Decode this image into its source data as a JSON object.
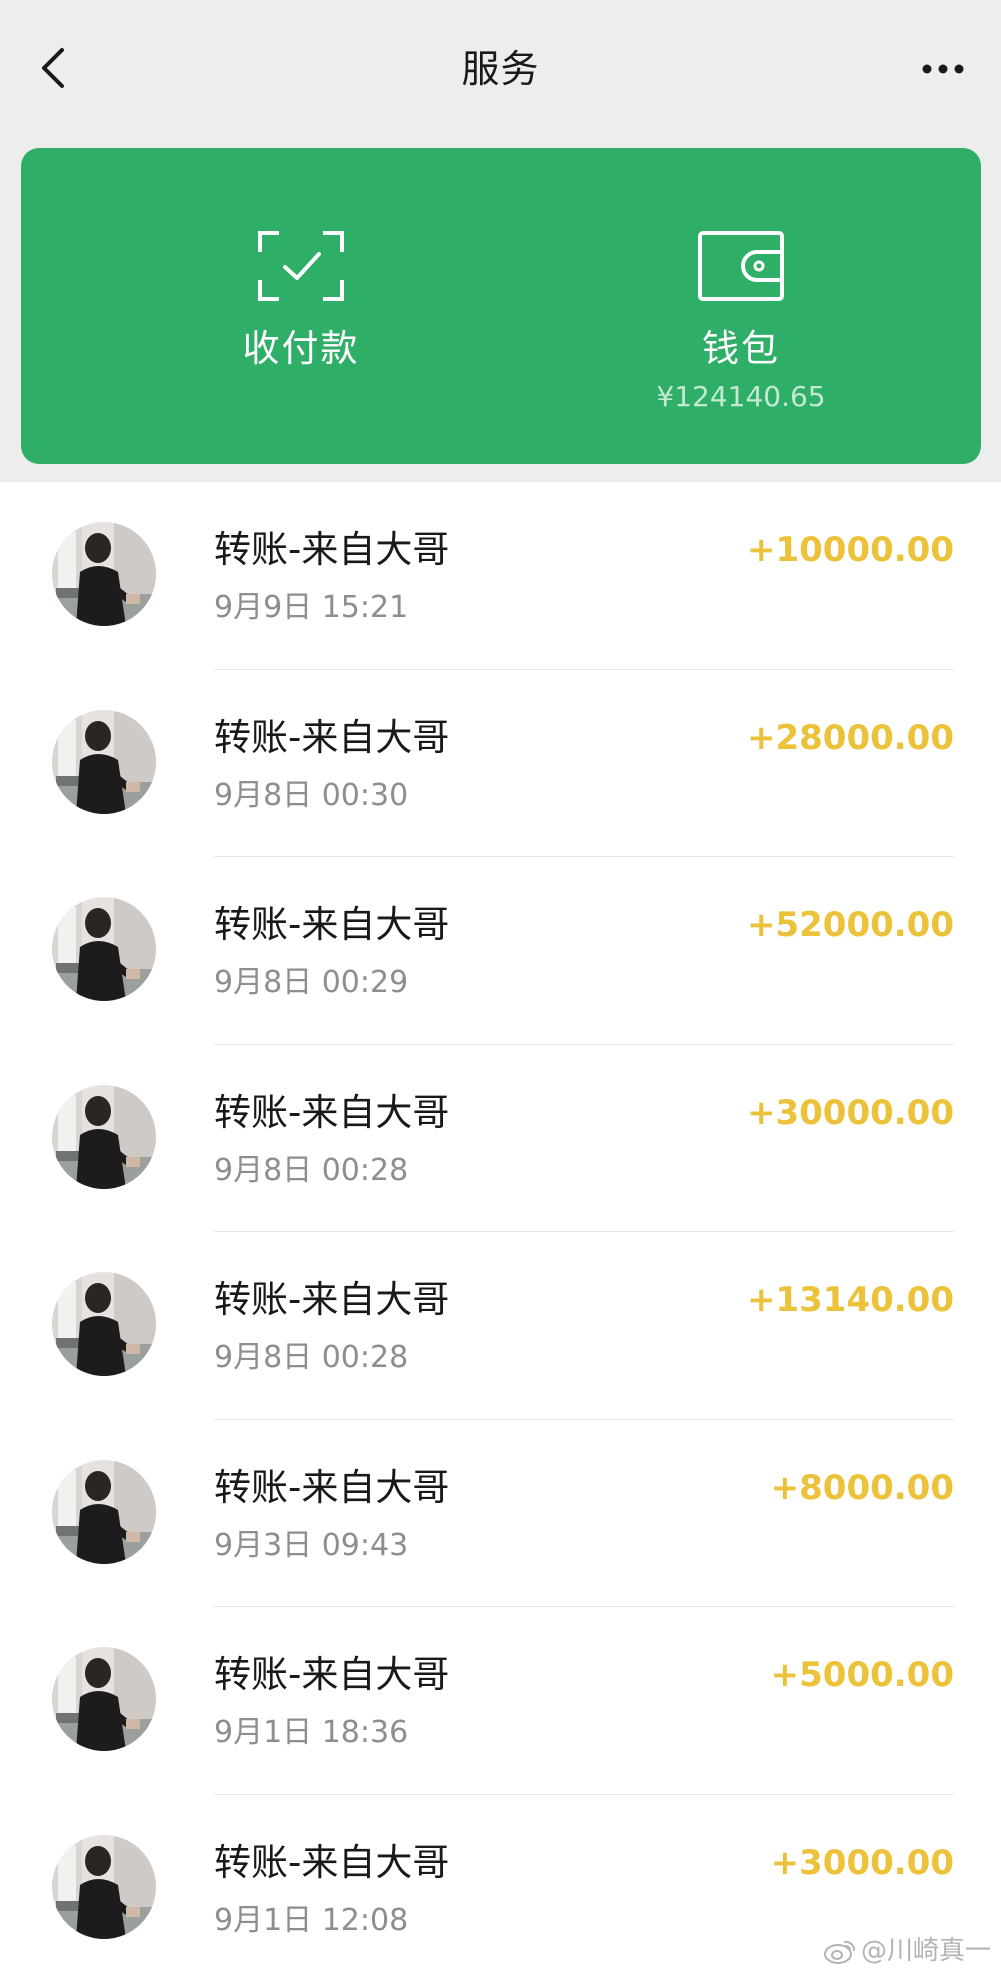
{
  "header": {
    "title": "服务",
    "back_icon": "chevron-left-icon",
    "more_icon": "more-dots-icon"
  },
  "card": {
    "background": "#2eae67",
    "pay_label": "收付款",
    "pay_icon": "scan-check-icon",
    "wallet_label": "钱包",
    "wallet_icon": "wallet-icon",
    "wallet_balance": "¥124140.65"
  },
  "transactions": [
    {
      "title": "转账-来自大哥",
      "time": "9月9日 15:21",
      "amount": "+10000.00"
    },
    {
      "title": "转账-来自大哥",
      "time": "9月8日 00:30",
      "amount": "+28000.00"
    },
    {
      "title": "转账-来自大哥",
      "time": "9月8日 00:29",
      "amount": "+52000.00"
    },
    {
      "title": "转账-来自大哥",
      "time": "9月8日 00:28",
      "amount": "+30000.00"
    },
    {
      "title": "转账-来自大哥",
      "time": "9月8日 00:28",
      "amount": "+13140.00"
    },
    {
      "title": "转账-来自大哥",
      "time": "9月3日 09:43",
      "amount": "+8000.00"
    },
    {
      "title": "转账-来自大哥",
      "time": "9月1日 18:36",
      "amount": "+5000.00"
    },
    {
      "title": "转账-来自大哥",
      "time": "9月1日 12:08",
      "amount": "+3000.00"
    }
  ],
  "amount_color": "#ebc239",
  "watermark": {
    "text": "@川崎真一",
    "icon": "weibo-icon"
  }
}
